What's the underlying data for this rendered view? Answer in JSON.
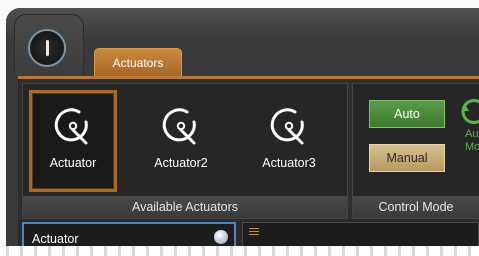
{
  "header": {
    "power_icon": "power-icon",
    "active_tab": "Actuators"
  },
  "ribbon": {
    "actuators_group": {
      "caption": "Available Actuators",
      "items": [
        {
          "label": "Actuator",
          "icon": "actuator-rotate-icon",
          "selected": true
        },
        {
          "label": "Actuator2",
          "icon": "actuator-rotate-icon",
          "selected": false
        },
        {
          "label": "Actuator3",
          "icon": "actuator-rotate-icon",
          "selected": false
        }
      ]
    },
    "control_group": {
      "caption": "Control Mode",
      "auto_label": "Auto",
      "manual_label": "Manual",
      "auto_mode_icon": "auto-mode-icon",
      "auto_mode_text_1": "Au",
      "auto_mode_text_2": "Mo"
    }
  },
  "lower": {
    "actuator_panel_title": "Actuator",
    "status_icon": "status-indicator-icon",
    "menu_icon": "menu-icon"
  },
  "colors": {
    "accent_orange": "#b87a33",
    "auto_green": "#4a8c3c",
    "manual_tan": "#c8ad76",
    "selection_blue": "#4d86c6"
  }
}
